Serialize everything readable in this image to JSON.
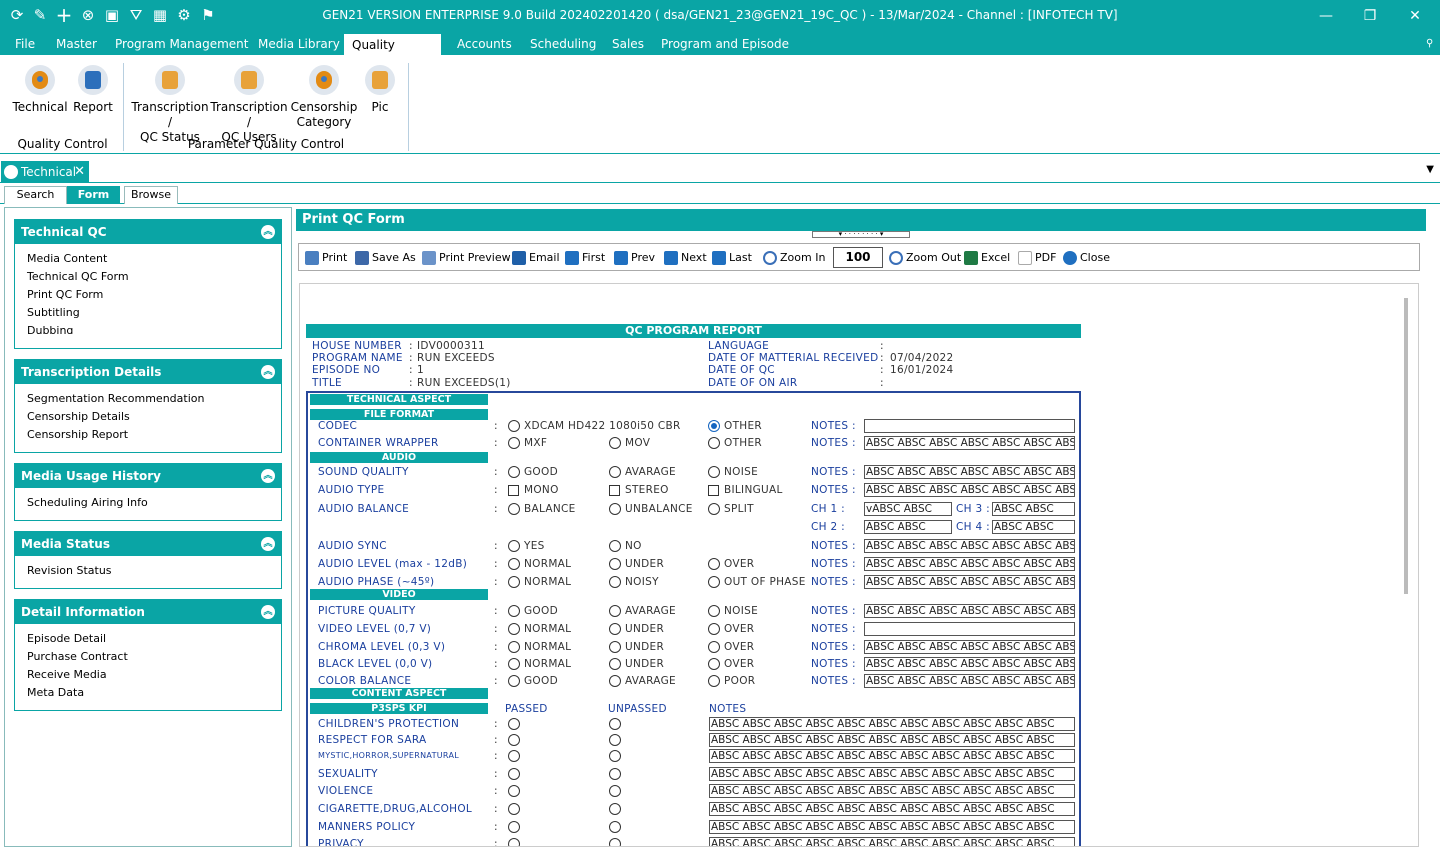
{
  "window": {
    "title": "GEN21 VERSION ENTERPRISE 9.0 Build 202402201420 ( dsa/GEN21_23@GEN21_19C_QC ) - 13/Mar/2024 - Channel : [INFOTECH TV]"
  },
  "menu": [
    "File",
    "Master",
    "Program Management",
    "Media Library",
    "Quality Control",
    "Accounts",
    "Scheduling",
    "Sales",
    "Program and Episode"
  ],
  "ribbon": {
    "buttons": [
      {
        "l1": "Technical",
        "l2": ""
      },
      {
        "l1": "Report",
        "l2": ""
      },
      {
        "l1": "Transcription /",
        "l2": "QC Status"
      },
      {
        "l1": "Transcription /",
        "l2": "QC Users"
      },
      {
        "l1": "Censorship",
        "l2": "Category"
      },
      {
        "l1": "Pic",
        "l2": ""
      }
    ],
    "groups": [
      "Quality Control",
      "Parameter Quality Control"
    ]
  },
  "doc_tab": "Technical",
  "subtabs": [
    "Search",
    "Form",
    "Browse"
  ],
  "nav": [
    {
      "title": "Technical QC",
      "items": [
        "Media Content",
        "Technical QC Form",
        "Print QC Form",
        "Subtitling",
        "Dubbing"
      ]
    },
    {
      "title": "Transcription Details",
      "items": [
        "Segmentation Recommendation",
        "Censorship Details",
        "Censorship Report"
      ]
    },
    {
      "title": "Media Usage History",
      "items": [
        "Scheduling Airing Info"
      ]
    },
    {
      "title": "Media Status",
      "items": [
        "Revision Status"
      ]
    },
    {
      "title": "Detail Information",
      "items": [
        "Episode Detail",
        "Purchase Contract",
        "Receive Media",
        "Meta Data"
      ]
    }
  ],
  "form_title": "Print QC Form",
  "toolbar": {
    "print": "Print",
    "save_as": "Save As",
    "print_preview": "Print Preview",
    "email": "Email",
    "first": "First",
    "prev": "Prev",
    "next": "Next",
    "last": "Last",
    "zoom_in": "Zoom In",
    "zoom": "100",
    "zoom_out": "Zoom Out",
    "excel": "Excel",
    "pdf": "PDF",
    "close": "Close"
  },
  "report": {
    "title": "QC PROGRAM REPORT",
    "header_left": [
      {
        "label": "HOUSE NUMBER",
        "value": "IDV0000311"
      },
      {
        "label": "PROGRAM NAME",
        "value": "RUN EXCEEDS"
      },
      {
        "label": "EPISODE NO",
        "value": "1"
      },
      {
        "label": "TITLE",
        "value": "RUN EXCEEDS(1)"
      }
    ],
    "header_right": [
      {
        "label": "LANGUAGE",
        "value": ""
      },
      {
        "label": "DATE OF MATTERIAL RECEIVED",
        "value": "07/04/2022"
      },
      {
        "label": "DATE OF QC",
        "value": "16/01/2024"
      },
      {
        "label": "DATE OF ON AIR",
        "value": ""
      }
    ],
    "sections": {
      "technical": "TECHNICAL ASPECT",
      "file_format": "FILE FORMAT",
      "audio": "AUDIO",
      "video": "VIDEO",
      "content": "CONTENT ASPECT",
      "kpi": "P3SPS KPI"
    },
    "notes_label": "NOTES :",
    "notes_long": "ABSC ABSC ABSC ABSC ABSC ABSC ABSC",
    "notes_kpi": "ABSC ABSC ABSC ABSC ABSC ABSC ABSC ABSC ABSC ABSC ABSC",
    "rows": [
      {
        "label": "CODEC",
        "opts": [
          "XDCAM HD422 1080i50 CBR",
          "OTHER"
        ],
        "notes": ""
      },
      {
        "label": "CONTAINER WRAPPER",
        "opts": [
          "MXF",
          "MOV",
          "OTHER"
        ],
        "notes": "ABSC ABSC ABSC ABSC ABSC ABSC ABSC"
      },
      {
        "label": "SOUND QUALITY",
        "opts": [
          "GOOD",
          "AVARAGE",
          "NOISE"
        ],
        "notes": "ABSC ABSC ABSC ABSC ABSC ABSC ABSC"
      },
      {
        "label": "AUDIO TYPE",
        "opts": [
          "MONO",
          "STEREO",
          "BILINGUAL"
        ],
        "notes": "ABSC ABSC ABSC ABSC ABSC ABSC ABSC"
      },
      {
        "label": "AUDIO BALANCE",
        "opts": [
          "BALANCE",
          "UNBALANCE",
          "SPLIT"
        ]
      },
      {
        "label": "AUDIO SYNC",
        "opts": [
          "YES",
          "NO"
        ],
        "notes": "ABSC ABSC ABSC ABSC ABSC ABSC ABSC"
      },
      {
        "label": "AUDIO LEVEL (max - 12dB)",
        "opts": [
          "NORMAL",
          "UNDER",
          "OVER"
        ],
        "notes": "ABSC ABSC ABSC ABSC ABSC ABSC ABSC"
      },
      {
        "label": "AUDIO PHASE (~45º)",
        "opts": [
          "NORMAL",
          "NOISY",
          "OUT OF PHASE"
        ],
        "notes": "ABSC ABSC ABSC ABSC ABSC ABSC ABSC"
      },
      {
        "label": "PICTURE QUALITY",
        "opts": [
          "GOOD",
          "AVARAGE",
          "NOISE"
        ],
        "notes": "ABSC ABSC ABSC ABSC ABSC ABSC ABSC"
      },
      {
        "label": "VIDEO LEVEL (0,7 V)",
        "opts": [
          "NORMAL",
          "UNDER",
          "OVER"
        ],
        "notes": ""
      },
      {
        "label": "CHROMA LEVEL (0,3 V)",
        "opts": [
          "NORMAL",
          "UNDER",
          "OVER"
        ],
        "notes": "ABSC ABSC ABSC ABSC ABSC ABSC ABSC"
      },
      {
        "label": "BLACK LEVEL (0,0 V)",
        "opts": [
          "NORMAL",
          "UNDER",
          "OVER"
        ],
        "notes": "ABSC ABSC ABSC ABSC ABSC ABSC ABSC"
      },
      {
        "label": "COLOR BALANCE",
        "opts": [
          "GOOD",
          "AVARAGE",
          "POOR"
        ],
        "notes": "ABSC ABSC ABSC ABSC ABSC ABSC ABSC"
      }
    ],
    "channels": {
      "ch1": "CH 1 :",
      "ch1_val": "vABSC ABSC",
      "ch2": "CH 2 :",
      "ch2_val": "ABSC ABSC",
      "ch3": "CH 3 :",
      "ch3_val": "ABSC ABSC",
      "ch4": "CH 4 :",
      "ch4_val": "ABSC ABSC"
    },
    "kpi_headers": {
      "passed": "PASSED",
      "unpassed": "UNPASSED",
      "notes": "NOTES"
    },
    "kpi_rows": [
      "CHILDREN'S PROTECTION",
      "RESPECT FOR SARA",
      "MYSTIC,HORROR,SUPERNATURAL",
      "SEXUALITY",
      "VIOLENCE",
      "CIGARETTE,DRUG,ALCOHOL",
      "MANNERS POLICY",
      "PRIVACY"
    ]
  },
  "colors": {
    "accent": "#0aa5a5",
    "report_blue": "#1a3f9e",
    "radio_selected": "#1565c0"
  }
}
